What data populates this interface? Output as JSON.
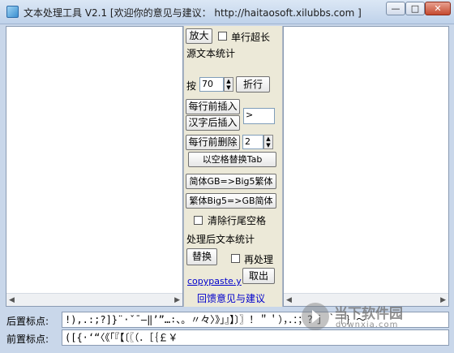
{
  "window": {
    "title": "文本处理工具 V2.1 [欢迎你的意见与建议： http://haitaosoft.xilubbs.com ]",
    "min_glyph": "—",
    "max_glyph": "□",
    "close_glyph": "✕"
  },
  "panel": {
    "zoom_button": "放大",
    "single_line_overlength": "单行超长",
    "source_stats": "源文本统计",
    "wrap_by_label": "按",
    "wrap_value": "70",
    "wrap_button": "折行",
    "insert_each_line_front": "每行前插入",
    "insert_after_chinese": "汉字后插入",
    "insert_value": ">",
    "delete_each_line_front": "每行前删除",
    "delete_value": "2",
    "replace_space_with_tab": "以空格替换Tab",
    "gb_to_big5": "简体GB=>Big5繁体",
    "big5_to_gb": "繁体Big5=>GB简体",
    "clear_trailing_spaces": "清除行尾空格",
    "processed_stats": "处理后文本统计",
    "replace_button": "替换",
    "reprocess": "再处理",
    "fetch_button": "取出",
    "copypaste_link": "copypaste.y",
    "feedback_link": "回馈意见与建议"
  },
  "bottom": {
    "trailing_punct_label": "后置标点:",
    "trailing_punct_value": "!),.:;?]}¨·ˇˉ―‖’”…∶、。〃々〉》」』】〕〗！＂＇），．：；？］｀｜｝～",
    "leading_punct_label": "前置标点:",
    "leading_punct_value": "([{·‘“〈《「『【〔〖（．［｛￡￥"
  },
  "watermark": {
    "name": "当下软件园",
    "url": "downxia.com"
  }
}
